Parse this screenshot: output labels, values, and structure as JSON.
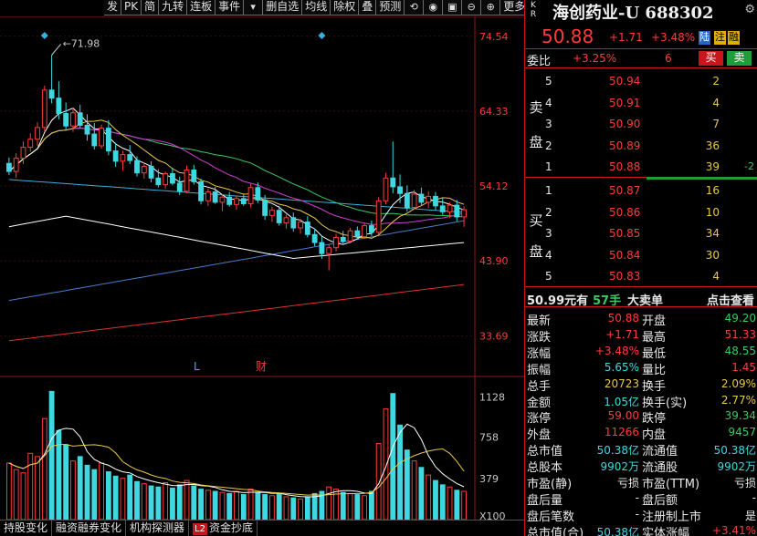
{
  "toolbar": {
    "items": [
      "发",
      "PK",
      "简",
      "九转",
      "连板",
      "事件",
      "",
      "删自选",
      "均线",
      "除权",
      "叠",
      "预测",
      "",
      "",
      "",
      "",
      "更多",
      "",
      ""
    ],
    "icons": [
      "chevron-down-icon",
      "refresh-icon",
      "eye-icon",
      "lock-icon",
      "zoom-out-icon",
      "zoom-in-icon",
      "panel-toggle-icon",
      "chevron-down-icon"
    ]
  },
  "chart_data": {
    "type": "candlestick",
    "price_axis": {
      "ticks": [
        "74.54",
        "64.33",
        "54.12",
        "43.90",
        "33.69"
      ],
      "ylim": [
        30.0,
        77.0
      ]
    },
    "volume_axis": {
      "ticks": [
        "1128",
        "758",
        "379",
        "X100"
      ],
      "ylim": [
        0,
        1250
      ]
    },
    "annotations": {
      "high_label": "71.98",
      "markers": [
        "L",
        "财"
      ]
    },
    "ohlc": [
      [
        57.2,
        58.0,
        55.6,
        56.1
      ],
      [
        56.1,
        58.6,
        55.2,
        57.9
      ],
      [
        57.9,
        60.2,
        57.1,
        59.4
      ],
      [
        59.4,
        61.3,
        58.8,
        60.5
      ],
      [
        60.5,
        62.8,
        59.6,
        62.1
      ],
      [
        62.1,
        67.8,
        61.5,
        67.2
      ],
      [
        67.2,
        71.98,
        65.4,
        66.1
      ],
      [
        66.1,
        68.4,
        63.2,
        64.0
      ],
      [
        64.0,
        65.5,
        61.7,
        62.3
      ],
      [
        62.3,
        64.8,
        61.5,
        64.1
      ],
      [
        64.1,
        65.2,
        62.0,
        62.4
      ],
      [
        62.4,
        63.9,
        60.3,
        61.2
      ],
      [
        61.2,
        62.7,
        59.1,
        59.6
      ],
      [
        59.6,
        62.5,
        59.2,
        62.0
      ],
      [
        62.0,
        63.1,
        58.3,
        58.9
      ],
      [
        58.9,
        60.0,
        56.7,
        57.5
      ],
      [
        57.5,
        58.9,
        56.2,
        58.4
      ],
      [
        58.4,
        59.7,
        57.1,
        57.6
      ],
      [
        57.6,
        58.2,
        55.4,
        55.9
      ],
      [
        55.9,
        57.3,
        55.1,
        56.8
      ],
      [
        56.8,
        57.5,
        54.6,
        55.2
      ],
      [
        55.2,
        56.4,
        53.9,
        54.3
      ],
      [
        54.3,
        56.1,
        53.7,
        55.8
      ],
      [
        55.8,
        56.6,
        54.2,
        54.5
      ],
      [
        54.5,
        55.4,
        52.9,
        53.4
      ],
      [
        53.4,
        56.9,
        53.1,
        56.3
      ],
      [
        56.3,
        57.0,
        54.3,
        54.7
      ],
      [
        54.7,
        55.1,
        51.6,
        52.1
      ],
      [
        52.1,
        53.8,
        51.4,
        53.3
      ],
      [
        53.3,
        54.0,
        51.7,
        51.9
      ],
      [
        51.9,
        53.0,
        50.7,
        52.6
      ],
      [
        52.6,
        53.3,
        51.3,
        51.6
      ],
      [
        51.6,
        52.8,
        50.9,
        52.4
      ],
      [
        52.4,
        53.0,
        51.4,
        51.7
      ],
      [
        51.7,
        54.4,
        51.2,
        53.9
      ],
      [
        53.9,
        54.6,
        51.8,
        52.2
      ],
      [
        52.2,
        52.9,
        49.5,
        50.1
      ],
      [
        50.1,
        51.3,
        49.2,
        50.8
      ],
      [
        50.8,
        51.4,
        48.7,
        49.1
      ],
      [
        49.1,
        50.2,
        48.3,
        49.8
      ],
      [
        49.8,
        50.5,
        47.9,
        48.4
      ],
      [
        48.4,
        49.6,
        47.6,
        49.2
      ],
      [
        49.2,
        50.0,
        47.1,
        47.5
      ],
      [
        47.5,
        48.3,
        45.9,
        46.4
      ],
      [
        46.4,
        47.2,
        44.2,
        44.9
      ],
      [
        44.9,
        46.1,
        42.6,
        45.7
      ],
      [
        45.7,
        47.6,
        45.2,
        47.1
      ],
      [
        47.1,
        48.0,
        46.1,
        46.6
      ],
      [
        46.6,
        48.4,
        46.3,
        48.0
      ],
      [
        48.0,
        48.6,
        46.8,
        47.2
      ],
      [
        47.2,
        49.1,
        46.9,
        48.7
      ],
      [
        48.7,
        49.4,
        47.3,
        47.8
      ],
      [
        47.8,
        52.6,
        47.5,
        52.1
      ],
      [
        52.1,
        55.9,
        51.6,
        55.2
      ],
      [
        55.2,
        60.2,
        53.1,
        54.0
      ],
      [
        54.0,
        55.7,
        51.8,
        53.1
      ],
      [
        53.1,
        54.2,
        50.6,
        51.2
      ],
      [
        51.2,
        53.6,
        50.9,
        53.0
      ],
      [
        53.0,
        53.9,
        51.4,
        51.9
      ],
      [
        51.9,
        53.4,
        51.1,
        52.7
      ],
      [
        52.7,
        53.3,
        50.8,
        51.4
      ],
      [
        51.4,
        52.5,
        50.2,
        50.6
      ],
      [
        50.6,
        51.9,
        49.8,
        51.5
      ],
      [
        51.5,
        52.2,
        49.3,
        49.9
      ],
      [
        49.9,
        51.33,
        48.55,
        50.88
      ]
    ],
    "volume": [
      520,
      460,
      430,
      610,
      580,
      930,
      1180,
      820,
      690,
      540,
      580,
      500,
      460,
      520,
      440,
      400,
      380,
      410,
      350,
      330,
      310,
      300,
      340,
      290,
      320,
      360,
      310,
      280,
      270,
      260,
      250,
      240,
      260,
      230,
      280,
      250,
      230,
      220,
      240,
      210,
      200,
      190,
      210,
      240,
      260,
      300,
      280,
      250,
      240,
      230,
      220,
      260,
      700,
      1020,
      1160,
      870,
      640,
      540,
      480,
      410,
      360,
      320,
      300,
      270,
      260
    ],
    "vol_colors_up": [
      true,
      true,
      true,
      true,
      true,
      true,
      false,
      false,
      false,
      true,
      false,
      false,
      false,
      true,
      false,
      false,
      true,
      false,
      false,
      true,
      false,
      false,
      true,
      false,
      false,
      true,
      false,
      false,
      true,
      false,
      true,
      false,
      true,
      false,
      true,
      false,
      false,
      true,
      false,
      true,
      false,
      true,
      false,
      false,
      false,
      true,
      true,
      false,
      true,
      false,
      true,
      false,
      true,
      true,
      false,
      false,
      false,
      true,
      false,
      true,
      false,
      false,
      true,
      false,
      true
    ]
  },
  "bottom_tabs": [
    "持股变化",
    "融资融券变化",
    "机构探测器",
    "资金抄底"
  ],
  "bottom_tab_badge": "L2",
  "header": {
    "kr": [
      "K",
      "R"
    ],
    "name": "海创药业-U 688302",
    "gear": "⚙"
  },
  "quote": {
    "price": "50.88",
    "change": "+1.71",
    "change_pct": "+3.48%",
    "tags": [
      "陆",
      "注",
      "融"
    ]
  },
  "weibi": {
    "label": "委比",
    "value": "+3.25%",
    "diff": "6",
    "buy": "买",
    "sell": "卖"
  },
  "sell_label": [
    "卖",
    "盘"
  ],
  "buy_label": [
    "买",
    "盘"
  ],
  "sell_orders": [
    {
      "idx": "5",
      "price": "50.94",
      "vol": "2",
      "extra": ""
    },
    {
      "idx": "4",
      "price": "50.91",
      "vol": "4",
      "extra": ""
    },
    {
      "idx": "3",
      "price": "50.90",
      "vol": "7",
      "extra": ""
    },
    {
      "idx": "2",
      "price": "50.89",
      "vol": "36",
      "extra": ""
    },
    {
      "idx": "1",
      "price": "50.88",
      "vol": "39",
      "extra": "-2"
    }
  ],
  "buy_orders": [
    {
      "idx": "1",
      "price": "50.87",
      "vol": "16"
    },
    {
      "idx": "2",
      "price": "50.86",
      "vol": "10"
    },
    {
      "idx": "3",
      "price": "50.85",
      "vol": "34"
    },
    {
      "idx": "4",
      "price": "50.84",
      "vol": "30"
    },
    {
      "idx": "5",
      "price": "50.83",
      "vol": "4"
    }
  ],
  "big_order": {
    "price": "50.99元有",
    "qty": "57手",
    "label": "大卖单",
    "link": "点击查看"
  },
  "stats": [
    {
      "l": "最新",
      "lv": "50.88",
      "lc": "red",
      "r": "开盘",
      "rv": "49.20",
      "rc": "green"
    },
    {
      "l": "涨跌",
      "lv": "+1.71",
      "lc": "red",
      "r": "最高",
      "rv": "51.33",
      "rc": "red"
    },
    {
      "l": "涨幅",
      "lv": "+3.48%",
      "lc": "red",
      "r": "最低",
      "rv": "48.55",
      "rc": "green"
    },
    {
      "l": "振幅",
      "lv": "5.65%",
      "lc": "cyan",
      "r": "量比",
      "rv": "1.45",
      "rc": "red"
    },
    {
      "l": "总手",
      "lv": "20723",
      "lc": "yellow",
      "r": "换手",
      "rv": "2.09%",
      "rc": "yellow"
    },
    {
      "l": "金额",
      "lv": "1.05亿",
      "lc": "cyan",
      "r": "换手(实)",
      "rv": "2.77%",
      "rc": "yellow"
    },
    {
      "l": "涨停",
      "lv": "59.00",
      "lc": "red",
      "r": "跌停",
      "rv": "39.34",
      "rc": "green"
    },
    {
      "l": "外盘",
      "lv": "11266",
      "lc": "red",
      "r": "内盘",
      "rv": "9457",
      "rc": "green"
    },
    {
      "l": "总市值",
      "lv": "50.38亿",
      "lc": "cyan",
      "r": "流通值",
      "rv": "50.38亿",
      "rc": "cyan"
    },
    {
      "l": "总股本",
      "lv": "9902万",
      "lc": "cyan",
      "r": "流通股",
      "rv": "9902万",
      "rc": "cyan"
    },
    {
      "l": "市盈(静)",
      "lv": "亏损",
      "lc": "white",
      "r": "市盈(TTM)",
      "rv": "亏损",
      "rc": "white"
    },
    {
      "l": "盘后量",
      "lv": "-",
      "lc": "white",
      "r": "盘后额",
      "rv": "-",
      "rc": "white"
    },
    {
      "l": "盘后笔数",
      "lv": "-",
      "lc": "white",
      "r": "注册制上市",
      "rv": "是",
      "rc": "white"
    },
    {
      "l": "总市值(合)",
      "lv": "50.38亿",
      "lc": "cyan",
      "r": "实体涨幅",
      "rv": "+3.41%",
      "rc": "red"
    }
  ]
}
